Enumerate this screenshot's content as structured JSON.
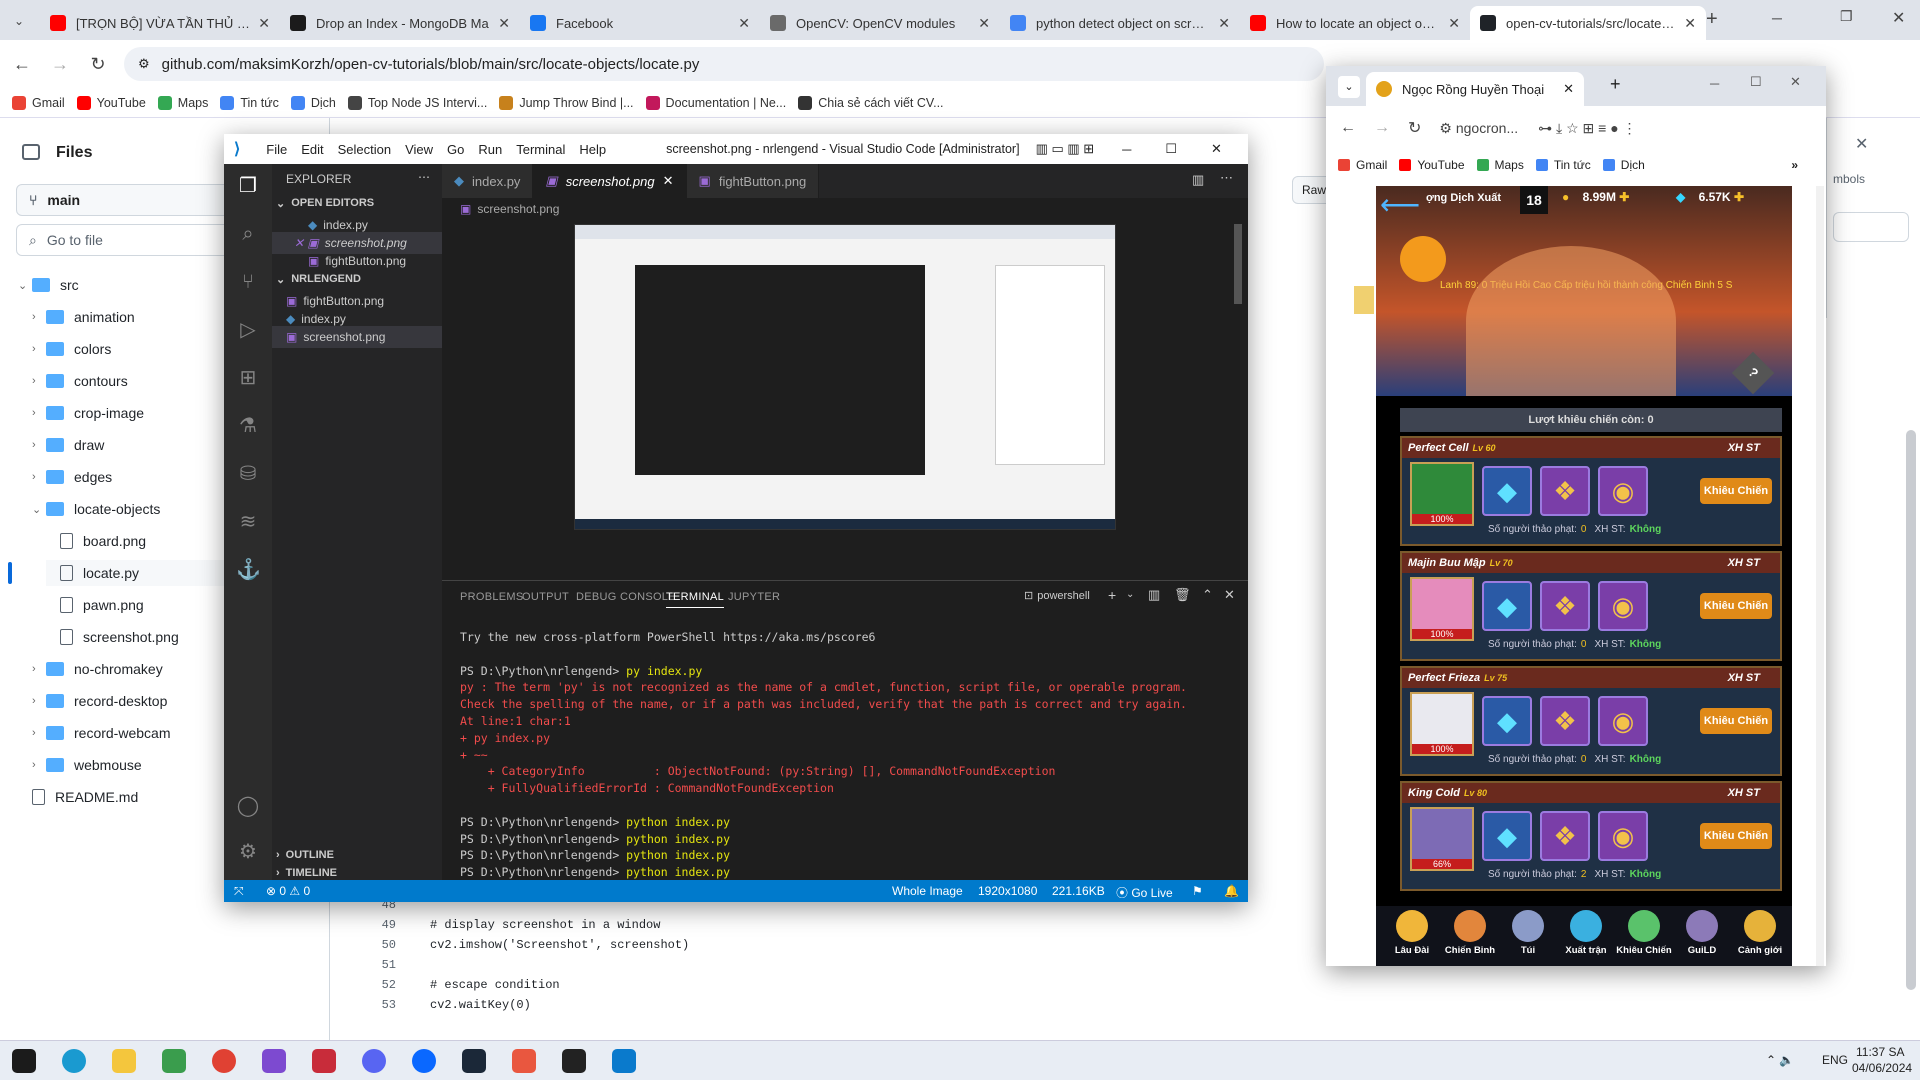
{
  "browser": {
    "tabs": [
      {
        "title": "[TRỌN BỘ] VỪA TẦN THỦ ĐÃ T",
        "color": "#ff0000"
      },
      {
        "title": "Drop an Index - MongoDB Ma",
        "color": "#1b1b1b"
      },
      {
        "title": "Facebook",
        "color": "#1877f2"
      },
      {
        "title": "OpenCV: OpenCV modules",
        "color": "#6a6a6a"
      },
      {
        "title": "python detect object on screen",
        "color": "#4285f4"
      },
      {
        "title": "How to locate an object on a s",
        "color": "#ff0000"
      },
      {
        "title": "open-cv-tutorials/src/locate-ob",
        "color": "#1f2328"
      }
    ],
    "url": "github.com/maksimKorzh/open-cv-tutorials/blob/main/src/locate-objects/locate.py",
    "bookmarks": [
      {
        "label": "Gmail",
        "color": "#ea4335"
      },
      {
        "label": "YouTube",
        "color": "#ff0000"
      },
      {
        "label": "Maps",
        "color": "#34a853"
      },
      {
        "label": "Tin tức",
        "color": "#4285f4"
      },
      {
        "label": "Dịch",
        "color": "#4285f4"
      },
      {
        "label": "Top Node JS Intervi...",
        "color": "#444"
      },
      {
        "label": "Jump Throw Bind |...",
        "color": "#c7811c"
      },
      {
        "label": "Documentation | Ne...",
        "color": "#c2185b"
      },
      {
        "label": "Chia sẻ cách viết CV...",
        "color": "#333"
      }
    ]
  },
  "github": {
    "files_title": "Files",
    "branch": "main",
    "goto_placeholder": "Go to file",
    "raw_label": "Raw",
    "symbols_label": "mbols",
    "tree": [
      {
        "label": "src",
        "kind": "folder",
        "depth": 0,
        "open": true
      },
      {
        "label": "animation",
        "kind": "folder",
        "depth": 1
      },
      {
        "label": "colors",
        "kind": "folder",
        "depth": 1
      },
      {
        "label": "contours",
        "kind": "folder",
        "depth": 1
      },
      {
        "label": "crop-image",
        "kind": "folder",
        "depth": 1
      },
      {
        "label": "draw",
        "kind": "folder",
        "depth": 1
      },
      {
        "label": "edges",
        "kind": "folder",
        "depth": 1
      },
      {
        "label": "locate-objects",
        "kind": "folder",
        "depth": 1,
        "open": true
      },
      {
        "label": "board.png",
        "kind": "file",
        "depth": 2
      },
      {
        "label": "locate.py",
        "kind": "file",
        "depth": 2,
        "selected": true
      },
      {
        "label": "pawn.png",
        "kind": "file",
        "depth": 2
      },
      {
        "label": "screenshot.png",
        "kind": "file",
        "depth": 2
      },
      {
        "label": "no-chromakey",
        "kind": "folder",
        "depth": 1
      },
      {
        "label": "record-desktop",
        "kind": "folder",
        "depth": 1
      },
      {
        "label": "record-webcam",
        "kind": "folder",
        "depth": 1
      },
      {
        "label": "webmouse",
        "kind": "folder",
        "depth": 1
      },
      {
        "label": "README.md",
        "kind": "file",
        "depth": 0
      }
    ],
    "code": [
      {
        "n": "48",
        "t": ""
      },
      {
        "n": "49",
        "t": "# display screenshot in a window"
      },
      {
        "n": "50",
        "t": "cv2.imshow('Screenshot', screenshot)"
      },
      {
        "n": "51",
        "t": ""
      },
      {
        "n": "52",
        "t": "# escape condition"
      },
      {
        "n": "53",
        "t": "cv2.waitKey(0)"
      }
    ]
  },
  "vscode": {
    "menu": [
      "File",
      "Edit",
      "Selection",
      "View",
      "Go",
      "Run",
      "Terminal",
      "Help"
    ],
    "title": "screenshot.png - nrlengend - Visual Studio Code [Administrator]",
    "explorer_label": "EXPLORER",
    "open_editors_label": "OPEN EDITORS",
    "open_editors": [
      "index.py",
      "screenshot.png",
      "fightButton.png"
    ],
    "folder_label": "NRLENGEND",
    "folder_files": [
      "fightButton.png",
      "index.py",
      "screenshot.png"
    ],
    "outline_label": "OUTLINE",
    "timeline_label": "TIMELINE",
    "tabs": [
      "index.py",
      "screenshot.png",
      "fightButton.png"
    ],
    "breadcrumb": "screenshot.png",
    "panel_tabs": [
      "PROBLEMS",
      "OUTPUT",
      "DEBUG CONSOLE",
      "TERMINAL",
      "JUPYTER"
    ],
    "shell": "powershell",
    "terminal": [
      {
        "t": "Try the new cross-platform PowerShell https://aka.ms/pscore6",
        "c": ""
      },
      {
        "t": "",
        "c": ""
      },
      {
        "t": "PS D:\\Python\\nrlengend> ",
        "c": "",
        "cmd": "py index.py"
      },
      {
        "t": "py : The term 'py' is not recognized as the name of a cmdlet, function, script file, or operable program.",
        "c": "err"
      },
      {
        "t": "Check the spelling of the name, or if a path was included, verify that the path is correct and try again.",
        "c": "err"
      },
      {
        "t": "At line:1 char:1",
        "c": "err"
      },
      {
        "t": "+ py index.py",
        "c": "err"
      },
      {
        "t": "+ ~~",
        "c": "err"
      },
      {
        "t": "    + CategoryInfo          : ObjectNotFound: (py:String) [], CommandNotFoundException",
        "c": "err"
      },
      {
        "t": "    + FullyQualifiedErrorId : CommandNotFoundException",
        "c": "err"
      },
      {
        "t": "",
        "c": ""
      },
      {
        "t": "PS D:\\Python\\nrlengend> ",
        "c": "",
        "cmd": "python index.py"
      },
      {
        "t": "PS D:\\Python\\nrlengend> ",
        "c": "",
        "cmd": "python index.py"
      },
      {
        "t": "PS D:\\Python\\nrlengend> ",
        "c": "",
        "cmd": "python index.py"
      },
      {
        "t": "PS D:\\Python\\nrlengend> ",
        "c": "",
        "cmd": "python index.py"
      }
    ],
    "status": {
      "errors": "0",
      "warnings": "0",
      "image": "Whole Image",
      "dims": "1920x1080",
      "size": "221.16KB",
      "golive": "Go Live"
    }
  },
  "popup": {
    "title": "Ngọc Rồng Huyền Thoại",
    "url": "ngocron...",
    "bookmarks": [
      "Gmail",
      "YouTube",
      "Maps",
      "Tin tức",
      "Dịch"
    ],
    "game": {
      "level": "18",
      "gold": "8.99M",
      "gem": "6.57K",
      "banner": "ợng Dịch Xuất",
      "marquee": "Lanh 89: 0 Triệu Hồi Cao Cấp triệu hồi thành công Chiến Binh 5 S",
      "challenges": "Lượt khiêu chiến còn: 0",
      "bosses": [
        {
          "name": "Perfect Cell",
          "lv": "Lv 60",
          "hp": "100%",
          "count": "0",
          "rank": "Không",
          "avatar": "#2f8a3a"
        },
        {
          "name": "Majin Buu Mập",
          "lv": "Lv 70",
          "hp": "100%",
          "count": "0",
          "rank": "Không",
          "avatar": "#e58cbc"
        },
        {
          "name": "Perfect Frieza",
          "lv": "Lv 75",
          "hp": "100%",
          "count": "0",
          "rank": "Không",
          "avatar": "#e9e9ef"
        },
        {
          "name": "King Cold",
          "lv": "Lv 80",
          "hp": "66%",
          "count": "2",
          "rank": "Không",
          "avatar": "#7d6bb5"
        }
      ],
      "xh_label": "XH ST",
      "fight_label": "Khiêu Chiến",
      "people_label": "Số người thảo phạt:",
      "xh_st_label": "XH ST:",
      "bottom_nav": [
        "Lâu Đài",
        "Chiến Binh",
        "Túi",
        "Xuất trận",
        "Khiêu Chiến",
        "GuiLD",
        "Cảnh giới"
      ]
    }
  },
  "taskbar": {
    "lang": "ENG",
    "time": "11:37 SA",
    "date": "04/06/2024"
  }
}
